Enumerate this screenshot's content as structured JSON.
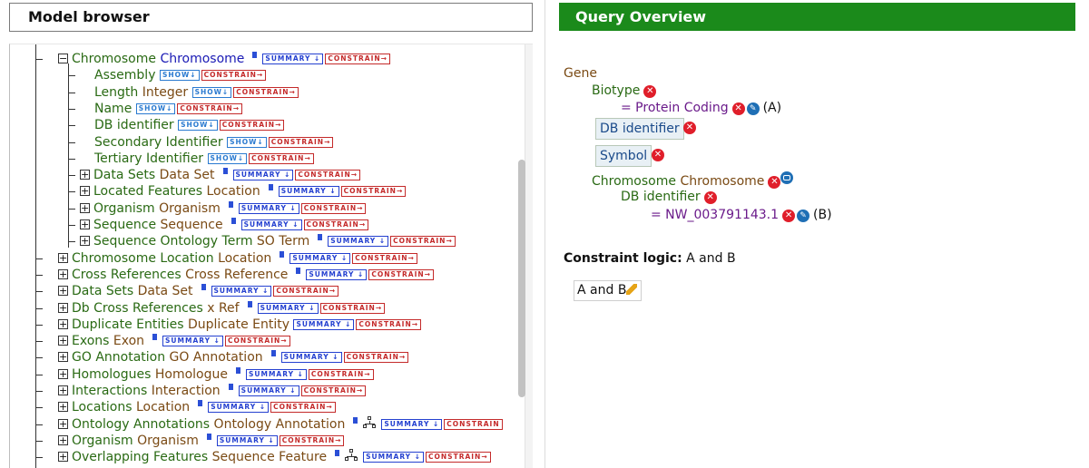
{
  "left_panel": {
    "title": "Model browser",
    "tree": [
      {
        "indent": 1,
        "expander": "minus",
        "name": "Chromosome",
        "type": "Chromosome",
        "tags": [
          "SUMMARY ↓",
          "CONSTRAIN→"
        ],
        "info": true,
        "type_color": "blue"
      },
      {
        "indent": 2,
        "expander": "none",
        "name": "Assembly",
        "type": "",
        "tags": [
          "SHOW↓",
          "CONSTRAIN→"
        ],
        "info": false
      },
      {
        "indent": 2,
        "expander": "none",
        "name": "Length",
        "type": "Integer",
        "tags": [
          "SHOW↓",
          "CONSTRAIN→"
        ],
        "info": false
      },
      {
        "indent": 2,
        "expander": "none",
        "name": "Name",
        "type": "",
        "tags": [
          "SHOW↓",
          "CONSTRAIN→"
        ],
        "info": false
      },
      {
        "indent": 2,
        "expander": "none",
        "name": "DB identifier",
        "type": "",
        "tags": [
          "SHOW↓",
          "CONSTRAIN→"
        ],
        "info": false
      },
      {
        "indent": 2,
        "expander": "none",
        "name": "Secondary Identifier",
        "type": "",
        "tags": [
          "SHOW↓",
          "CONSTRAIN→"
        ],
        "info": false
      },
      {
        "indent": 2,
        "expander": "none",
        "name": "Tertiary Identifier",
        "type": "",
        "tags": [
          "SHOW↓",
          "CONSTRAIN→"
        ],
        "info": false
      },
      {
        "indent": 2,
        "expander": "plus",
        "name": "Data Sets",
        "type": "Data Set",
        "tags": [
          "SUMMARY ↓",
          "CONSTRAIN→"
        ],
        "info": true
      },
      {
        "indent": 2,
        "expander": "plus",
        "name": "Located Features",
        "type": "Location",
        "tags": [
          "SUMMARY ↓",
          "CONSTRAIN→"
        ],
        "info": true
      },
      {
        "indent": 2,
        "expander": "plus",
        "name": "Organism",
        "type": "Organism",
        "tags": [
          "SUMMARY ↓",
          "CONSTRAIN→"
        ],
        "info": true
      },
      {
        "indent": 2,
        "expander": "plus",
        "name": "Sequence",
        "type": "Sequence",
        "tags": [
          "SUMMARY ↓",
          "CONSTRAIN→"
        ],
        "info": true
      },
      {
        "indent": 2,
        "expander": "plus",
        "name": "Sequence Ontology Term",
        "type": "SO Term",
        "tags": [
          "SUMMARY ↓",
          "CONSTRAIN→"
        ],
        "info": true
      },
      {
        "indent": 1,
        "expander": "plus",
        "name": "Chromosome Location",
        "type": "Location",
        "tags": [
          "SUMMARY ↓",
          "CONSTRAIN→"
        ],
        "info": true
      },
      {
        "indent": 1,
        "expander": "plus",
        "name": "Cross References",
        "type": "Cross Reference",
        "tags": [
          "SUMMARY ↓",
          "CONSTRAIN→"
        ],
        "info": true
      },
      {
        "indent": 1,
        "expander": "plus",
        "name": "Data Sets",
        "type": "Data Set",
        "tags": [
          "SUMMARY ↓",
          "CONSTRAIN→"
        ],
        "info": true
      },
      {
        "indent": 1,
        "expander": "plus",
        "name": "Db Cross References",
        "type": "x Ref",
        "tags": [
          "SUMMARY ↓",
          "CONSTRAIN→"
        ],
        "info": true
      },
      {
        "indent": 1,
        "expander": "plus",
        "name": "Duplicate Entities",
        "type": "Duplicate Entity",
        "tags": [
          "SUMMARY ↓",
          "CONSTRAIN→"
        ],
        "info": false
      },
      {
        "indent": 1,
        "expander": "plus",
        "name": "Exons",
        "type": "Exon",
        "tags": [
          "SUMMARY ↓",
          "CONSTRAIN→"
        ],
        "info": true
      },
      {
        "indent": 1,
        "expander": "plus",
        "name": "GO Annotation",
        "type": "GO Annotation",
        "tags": [
          "SUMMARY ↓",
          "CONSTRAIN→"
        ],
        "info": true
      },
      {
        "indent": 1,
        "expander": "plus",
        "name": "Homologues",
        "type": "Homologue",
        "tags": [
          "SUMMARY ↓",
          "CONSTRAIN→"
        ],
        "info": true
      },
      {
        "indent": 1,
        "expander": "plus",
        "name": "Interactions",
        "type": "Interaction",
        "tags": [
          "SUMMARY ↓",
          "CONSTRAIN→"
        ],
        "info": true
      },
      {
        "indent": 1,
        "expander": "plus",
        "name": "Locations",
        "type": "Location",
        "tags": [
          "SUMMARY ↓",
          "CONSTRAIN→"
        ],
        "info": true
      },
      {
        "indent": 1,
        "expander": "plus",
        "name": "Ontology Annotations",
        "type": "Ontology Annotation",
        "tags": [
          "SUMMARY ↓",
          "CONSTRAIN"
        ],
        "info": true,
        "tree_icon": true
      },
      {
        "indent": 1,
        "expander": "plus",
        "name": "Organism",
        "type": "Organism",
        "tags": [
          "SUMMARY ↓",
          "CONSTRAIN→"
        ],
        "info": true
      },
      {
        "indent": 1,
        "expander": "plus",
        "name": "Overlapping Features",
        "type": "Sequence Feature",
        "tags": [
          "SUMMARY ↓",
          "CONSTRAIN→"
        ],
        "info": true,
        "tree_icon": true
      }
    ]
  },
  "right_panel": {
    "title": "Query Overview",
    "root": "Gene",
    "biotype_label": "Biotype",
    "biotype_value": "= Protein Coding",
    "biotype_code": "(A)",
    "db_identifier_label": "DB identifier",
    "symbol_label": "Symbol",
    "chromosome_label": "Chromosome",
    "chromosome_type": "Chromosome",
    "chrom_db_identifier_label": "DB identifier",
    "chrom_db_value": "= NW_003791143.1",
    "chrom_db_code": "(B)",
    "constraint_logic_label": "Constraint logic:",
    "constraint_logic_value": "A and B",
    "logic_box_value": "A and B"
  }
}
